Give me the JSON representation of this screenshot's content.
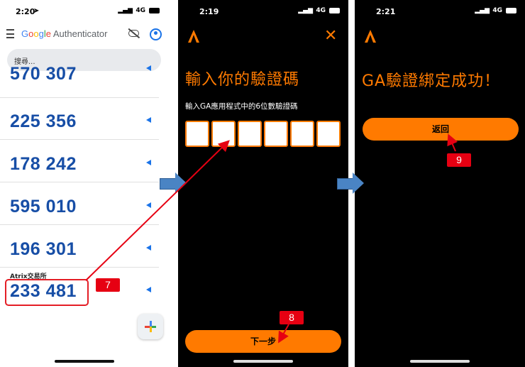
{
  "phone1": {
    "time": "2:20",
    "network": "4G",
    "app_title": {
      "g": "G",
      "o1": "o",
      "o2": "o",
      "g2": "g",
      "l": "l",
      "e": "e",
      "rest": " Authenticator"
    },
    "search_placeholder": "搜尋...",
    "codes": [
      {
        "account": "",
        "code": "570 307"
      },
      {
        "account": "",
        "code": "225 356"
      },
      {
        "account": "",
        "code": "178 242"
      },
      {
        "account": "",
        "code": "595 010"
      },
      {
        "account": "",
        "code": "196 301"
      },
      {
        "account": "Atrix交易所",
        "code": "233 481"
      }
    ]
  },
  "phone2": {
    "time": "2:19",
    "network": "4G",
    "heading": "輸入你的驗證碼",
    "subtitle": "輸入GA應用程式中的6位數驗證碼",
    "digits": [
      "",
      "",
      "",
      "",
      "",
      ""
    ],
    "next_button": "下一步"
  },
  "phone3": {
    "time": "2:21",
    "network": "4G",
    "heading": "GA驗證綁定成功！",
    "back_button": "返回"
  },
  "annotations": {
    "step7": "7",
    "step8": "8",
    "step9": "9"
  },
  "colors": {
    "accent": "#ff7a00",
    "code_blue": "#174ea6",
    "marker_red": "#e60012",
    "arrow_blue": "#4a84c4"
  }
}
